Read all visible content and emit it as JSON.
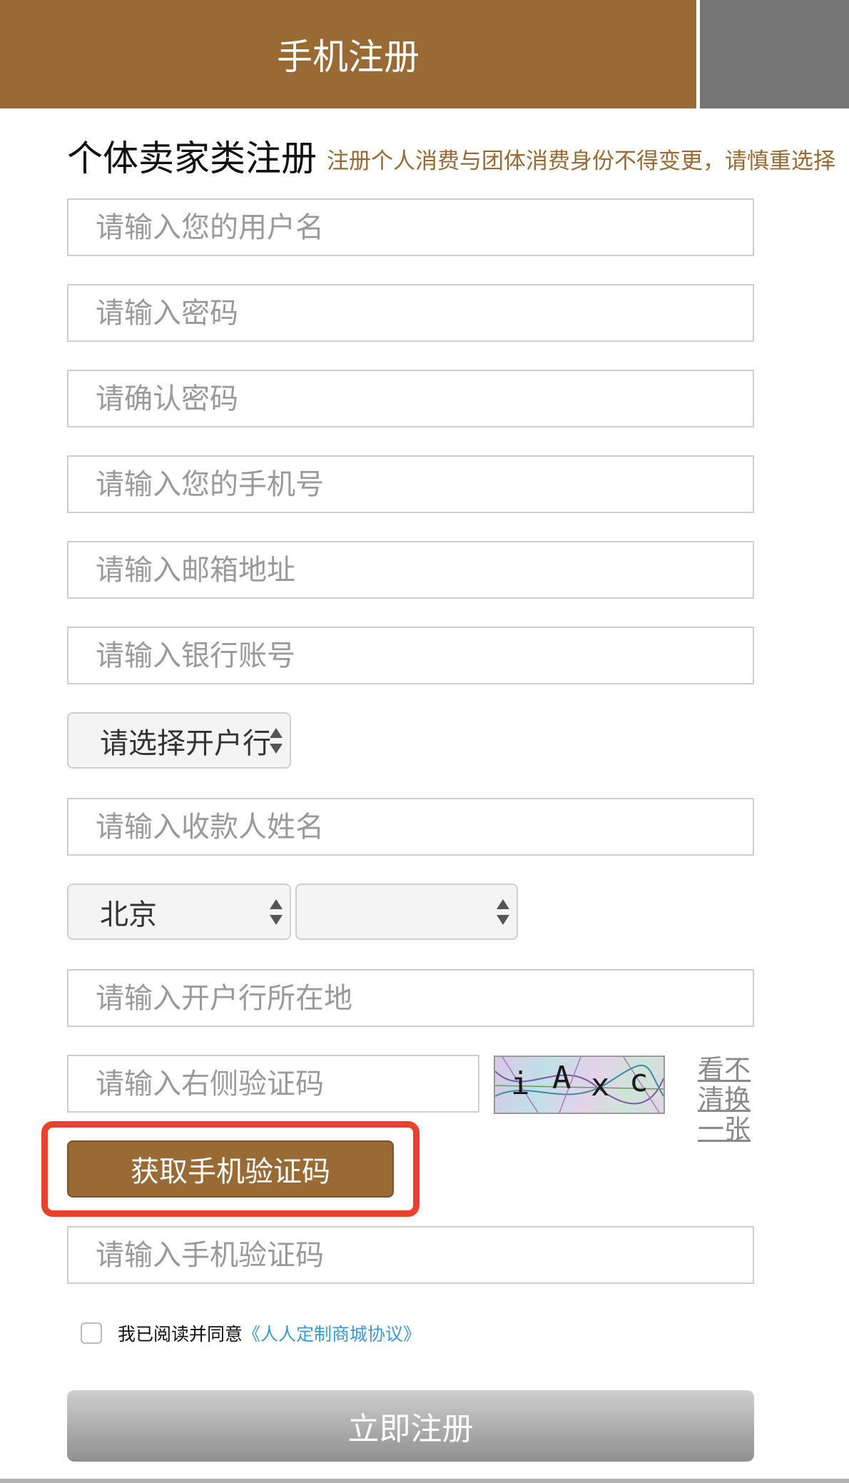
{
  "tabs": {
    "active_label": "手机注册"
  },
  "section": {
    "title": "个体卖家类注册",
    "notice": "注册个人消费与团体消费身份不得变更，请慎重选择"
  },
  "fields": {
    "username_placeholder": "请输入您的用户名",
    "password_placeholder": "请输入密码",
    "confirm_password_placeholder": "请确认密码",
    "phone_placeholder": "请输入您的手机号",
    "email_placeholder": "请输入邮箱地址",
    "bank_account_placeholder": "请输入银行账号",
    "bank_select_value": "请选择开户行",
    "payee_name_placeholder": "请输入收款人姓名",
    "province_value": "北京",
    "city_value": "",
    "bank_location_placeholder": "请输入开户行所在地",
    "captcha_placeholder": "请输入右侧验证码",
    "sms_code_placeholder": "请输入手机验证码"
  },
  "captcha": {
    "chars": [
      "i",
      "A",
      "x",
      "c"
    ],
    "refresh_label": "看不清换一张"
  },
  "sms_button_label": "获取手机验证码",
  "agreement": {
    "text": "我已阅读并同意",
    "link": "《人人定制商城协议》"
  },
  "submit_label": "立即注册",
  "colors": {
    "brand": "#996a33",
    "highlight": "#e8422c",
    "link": "#3a9ad9"
  }
}
